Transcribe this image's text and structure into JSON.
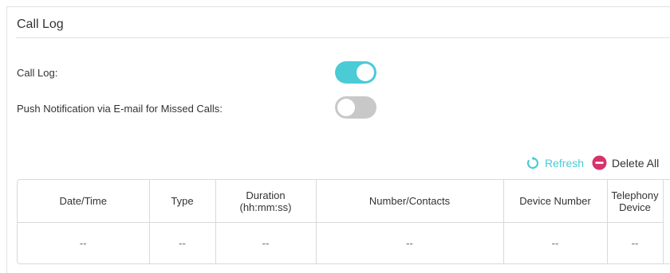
{
  "panel": {
    "title": "Call Log"
  },
  "settings": {
    "call_log": {
      "label": "Call Log:",
      "enabled": true
    },
    "push_notification": {
      "label": "Push Notification via E-mail for Missed Calls:",
      "enabled": false
    }
  },
  "toolbar": {
    "refresh_label": "Refresh",
    "delete_all_label": "Delete All"
  },
  "table": {
    "headers": [
      {
        "line1": "Date/Time",
        "line2": ""
      },
      {
        "line1": "Type",
        "line2": ""
      },
      {
        "line1": "Duration",
        "line2": "(hh:mm:ss)"
      },
      {
        "line1": "Number/Contacts",
        "line2": ""
      },
      {
        "line1": "Device Number",
        "line2": ""
      },
      {
        "line1": "Telephony",
        "line2": "Device"
      }
    ],
    "rows": [
      [
        "--",
        "--",
        "--",
        "--",
        "--",
        "--"
      ]
    ]
  },
  "colors": {
    "accent": "#4acbd6",
    "delete": "#d6336c",
    "toggle_off": "#c8c8c8"
  }
}
